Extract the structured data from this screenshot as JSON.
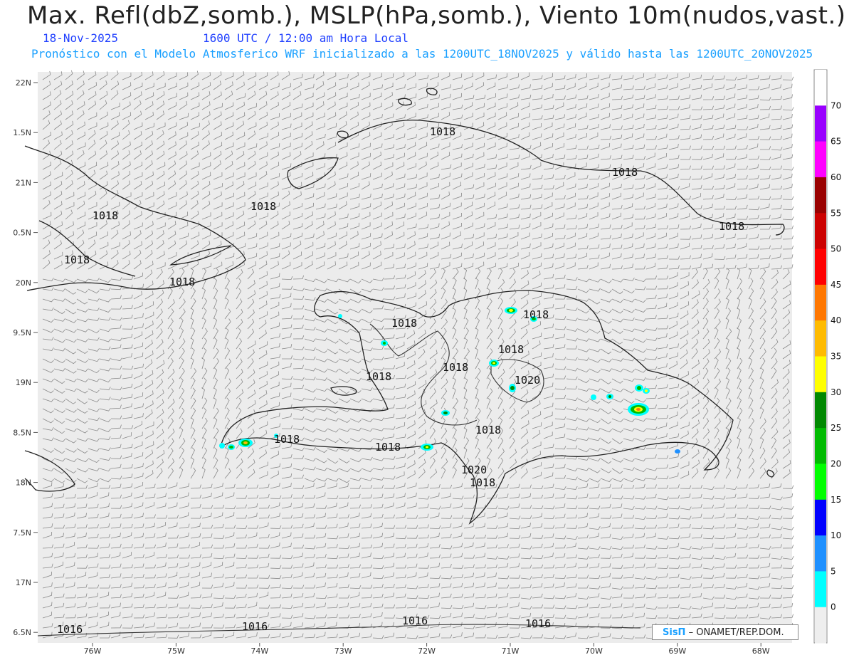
{
  "header": {
    "title": "Max. Refl(dbZ,somb.), MSLP(hPa,somb.), Viento 10m(nudos,vast.)",
    "date": "18-Nov-2025",
    "time": "1600 UTC / 12:00 am Hora Local",
    "model_info": "Pronóstico con el Modelo Atmosferico WRF inicializado a las 1200UTC_18NOV2025 y válido hasta las  1200UTC_20NOV2025"
  },
  "axes": {
    "lat_labels": [
      "22N",
      "1.5N",
      "21N",
      "0.5N",
      "20N",
      "9.5N",
      "19N",
      "8.5N",
      "18N",
      "7.5N",
      "17N",
      "6.5N"
    ],
    "lon_labels": [
      "76W",
      "75W",
      "74W",
      "73W",
      "72W",
      "71W",
      "70W",
      "69W",
      "68W"
    ]
  },
  "isobar_labels": [
    "1018",
    "1018",
    "1018",
    "1018",
    "1018",
    "1018",
    "1018",
    "1018",
    "1018",
    "1018",
    "1018",
    "1020",
    "1018",
    "1018",
    "1018",
    "1018",
    "1020",
    "1018",
    "1016",
    "1016",
    "1016",
    "1016"
  ],
  "colorbar": {
    "labels": [
      "70",
      "65",
      "60",
      "55",
      "50",
      "45",
      "40",
      "35",
      "30",
      "25",
      "20",
      "15",
      "10",
      "5",
      "0"
    ],
    "colors": [
      "#ffffff",
      "#9900ff",
      "#ff00ff",
      "#990000",
      "#cc0000",
      "#ff0000",
      "#ff7700",
      "#ffbb00",
      "#ffff00",
      "#008800",
      "#00bb00",
      "#00ff00",
      "#0000ff",
      "#1e90ff",
      "#00ffff",
      "#eeeeee"
    ]
  },
  "credit": {
    "brand": "SisΠ",
    "text": "– ONAMET/REP.DOM."
  }
}
